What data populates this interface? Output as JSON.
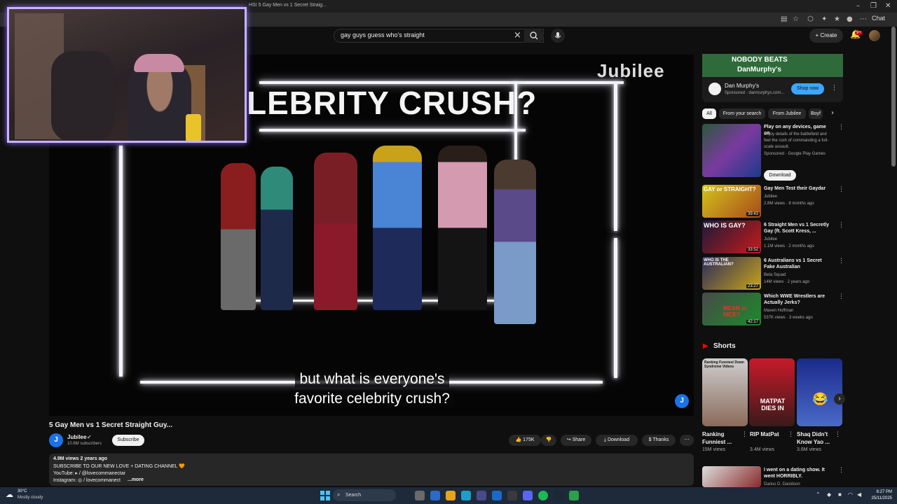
{
  "browser": {
    "tab_title": "HSI 5 Gay Men vs 1 Secret Straig...",
    "chat_label": "Chat"
  },
  "header": {
    "search_query": "gay guys guess who's straight",
    "create_label": "Create",
    "notification_count": "9+"
  },
  "video": {
    "banner_text": "LEBRITY CRUSH?",
    "logo_text": "Jubilee",
    "subtitle_line1": "but what is everyone's",
    "subtitle_line2": "favorite celebrity crush?",
    "title": "5 Gay Men vs 1 Secret Straight Guy...",
    "channel_name": "Jubilee",
    "channel_subscribers": "10.6M subscribers",
    "subscribe_label": "Subscribe",
    "likes": "175K",
    "share_label": "Share",
    "download_label": "Download",
    "thanks_label": "Thanks"
  },
  "description": {
    "stats": "4.9M views  2 years ago",
    "line1": "SUBSCRIBE TO OUR NEW LOVE + DATING CHANNEL 🧡",
    "line2": "YouTube:  ▸ / @lovecommanectar",
    "line3": "Instagram:  ◎ / lovecommanect",
    "more": "...more"
  },
  "sidebar": {
    "ad": {
      "banner_line1": "NOBODY BEATS",
      "banner_line2": "DanMurphy's",
      "name": "Dan Murphy's",
      "sponsor": "Sponsored · danmurphys.com...",
      "shop_label": "Shop now"
    },
    "chips": [
      "All",
      "From your search",
      "From Jubilee",
      "Boyf"
    ],
    "play_ad": {
      "title": "Play on any devices, game on",
      "desc": "Enjoy details of the battlefield and feel the rush of commanding a full-scale assault.",
      "sponsor": "Sponsored · Google Play Games",
      "download_label": "Download"
    },
    "recommendations": [
      {
        "title": "Gay Men Test their Gaydar",
        "channel": "Jubilee",
        "meta": "2.8M views · 8 months ago",
        "duration": "39:43",
        "thumb_text": "GAY or STRAIGHT?"
      },
      {
        "title": "6 Straight Men vs 1 Secretly Gay (ft. Scott Kress, ...",
        "channel": "Jubilee",
        "meta": "1.1M views · 2 months ago",
        "duration": "33:52",
        "thumb_text": "WHO IS GAY?"
      },
      {
        "title": "6 Australians vs 1 Secret Fake Australian",
        "channel": "Beta Squad",
        "meta": "14M views · 2 years ago",
        "duration": "23:27",
        "thumb_text": "WHO IS THE AUSTRALIAN?"
      },
      {
        "title": "Which WWE Wrestlers are Actually Jerks?",
        "channel": "Maven Huffman",
        "meta": "537K views · 3 weeks ago",
        "duration": "42:17",
        "thumb_text": "MEAN or NICE?"
      }
    ],
    "shorts_label": "Shorts",
    "shorts": [
      {
        "title": "Ranking Funniest ...",
        "views": "15M views",
        "thumb_text": "Ranking Funniest Down Syndrome Videos"
      },
      {
        "title": "RIP MatPat",
        "views": "3.4M views",
        "thumb_text": "MATPAT DIES IN"
      },
      {
        "title": "Shaq Didn't Know Yao ...",
        "views": "3.6M views",
        "thumb_text": "😂"
      }
    ],
    "last_rec": {
      "title": "I went on a dating show. It went HORRIBLY.",
      "channel": "Darius D. Davidson"
    }
  },
  "taskbar": {
    "temp": "30°C",
    "weather": "Mostly cloudy",
    "search_label": "Search",
    "time": "6:27 PM",
    "date": "25/11/2025"
  },
  "colors": {
    "accent": "#3ea6ff",
    "webcam_border": "#c8b2ff",
    "ad_banner": "#2f6b3a"
  }
}
